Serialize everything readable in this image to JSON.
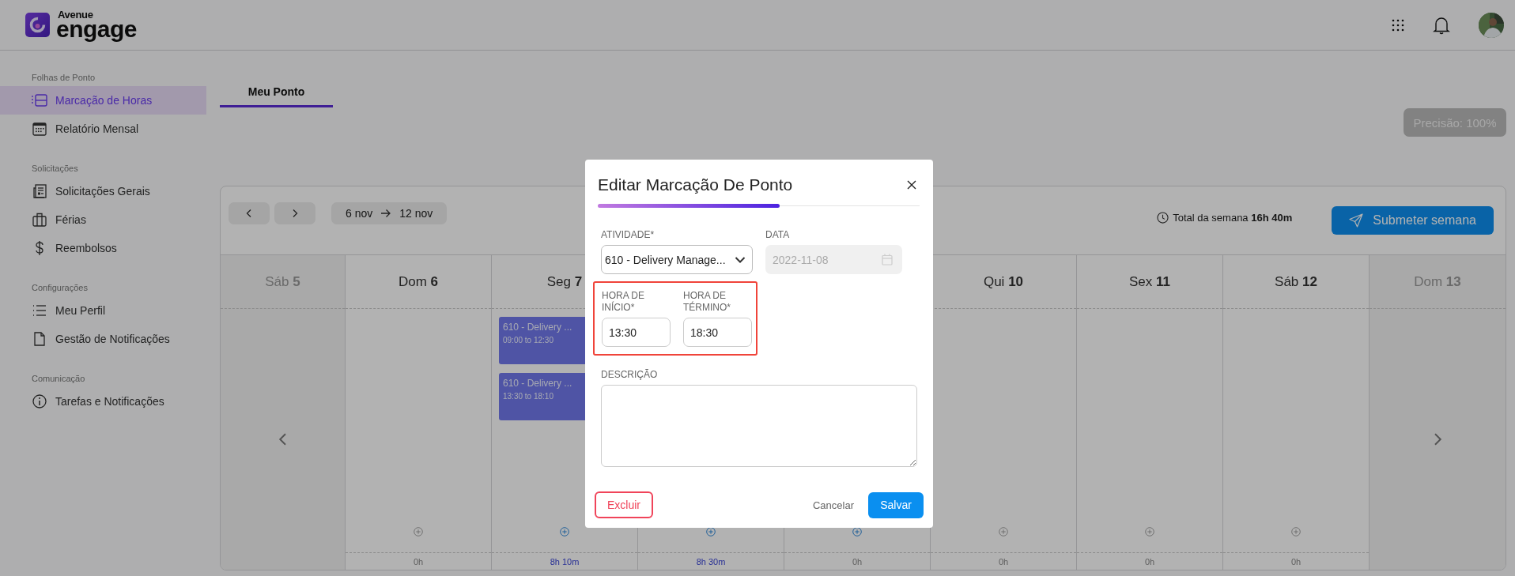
{
  "header": {
    "brand_prefix": "Avenue",
    "brand_name": "engage"
  },
  "sidebar": {
    "sections": [
      {
        "title": "Folhas de Ponto",
        "items": [
          {
            "label": "Marcação de Horas",
            "kind": "timesheet",
            "selected": true
          },
          {
            "label": "Relatório Mensal",
            "kind": "calendar",
            "selected": false
          }
        ]
      },
      {
        "title": "Solicitações",
        "items": [
          {
            "label": "Solicitações Gerais",
            "kind": "form",
            "selected": false
          },
          {
            "label": "Férias",
            "kind": "luggage",
            "selected": false
          },
          {
            "label": "Reembolsos",
            "kind": "money",
            "selected": false
          }
        ]
      },
      {
        "title": "Configurações",
        "items": [
          {
            "label": "Meu Perfil",
            "kind": "list",
            "selected": false
          },
          {
            "label": "Gestão de Notificações",
            "kind": "file",
            "selected": false
          }
        ]
      },
      {
        "title": "Comunicação",
        "items": [
          {
            "label": "Tarefas e Notificações",
            "kind": "info",
            "selected": false
          }
        ]
      }
    ]
  },
  "tabs": [
    {
      "label": "Meu Ponto",
      "selected": true
    }
  ],
  "precision_button": {
    "label": "Precisão: 100%",
    "disabled": true
  },
  "week": {
    "range_start": "6 nov",
    "range_end": "12 nov",
    "total": "Total da semana **16h 40m**",
    "submit_button": "Submeter semana",
    "days": [
      {
        "label": "Sáb **5**",
        "in_week": false
      },
      {
        "label": "Dom **6**",
        "in_week": true,
        "add_enabled": false,
        "total": "0h",
        "total_highlight": false
      },
      {
        "label": "Seg **7**",
        "in_week": true,
        "add_enabled": true,
        "total": "8h 10m",
        "total_highlight": true,
        "events": [
          {
            "title": "610 - Delivery ...",
            "time": "09:00 to 12:30"
          },
          {
            "title": "610 - Delivery ...",
            "time": "13:30 to 18:10"
          }
        ]
      },
      {
        "in_week": true,
        "add_enabled": true,
        "total": "8h 30m",
        "total_highlight": true
      },
      {
        "in_week": true,
        "add_enabled": true,
        "total": "0h",
        "total_highlight": false
      },
      {
        "label": "Qui **10**",
        "in_week": true,
        "add_enabled": false,
        "total": "0h",
        "total_highlight": false
      },
      {
        "label": "Sex **11**",
        "in_week": true,
        "add_enabled": false,
        "total": "0h",
        "total_highlight": false
      },
      {
        "label": "Sáb **12**",
        "in_week": true,
        "add_enabled": false,
        "total": "0h",
        "total_highlight": false
      },
      {
        "label": "Dom **13**",
        "in_week": false
      }
    ]
  },
  "modal": {
    "title": "Editar Marcação De Ponto",
    "activity": {
      "label": "ATIVIDADE*",
      "value": "610 - Delivery Manage..."
    },
    "date": {
      "label": "DATA",
      "value": "2022-11-08",
      "disabled": true
    },
    "time_group": {
      "highlighted": true,
      "start": {
        "label": "HORA DE INÍCIO*",
        "value": "13:30"
      },
      "end": {
        "label": "HORA DE TÉRMINO*",
        "value": "18:30"
      }
    },
    "description": {
      "label": "DESCRIÇÃO"
    },
    "delete_button": "Excluir",
    "cancel_button": "Cancelar",
    "save_button": "Salvar"
  }
}
